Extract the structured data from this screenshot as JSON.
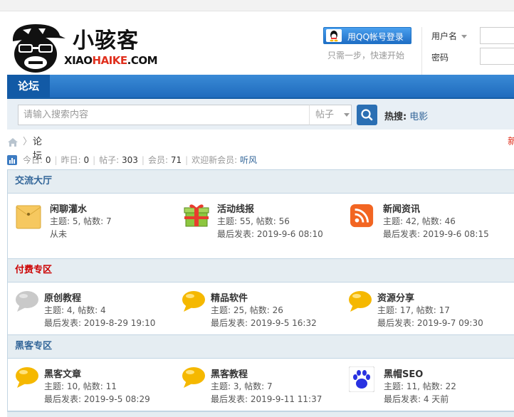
{
  "header": {
    "logo_text": "小骇客",
    "logo_domain_prefix": "XIAO",
    "logo_domain_highlight": "HAIKE",
    "logo_domain_suffix": ".COM",
    "qq_login_label": "用QQ帐号登录",
    "qq_tip": "只需一步，快速开始",
    "username_label": "用户名",
    "password_label": "密码"
  },
  "nav": {
    "active_tab": "论坛"
  },
  "search": {
    "placeholder": "请输入搜索内容",
    "scope": "帖子",
    "hot_label": "热搜:",
    "hot_links": [
      "电影"
    ]
  },
  "breadcrumb": {
    "current": "论坛",
    "right_cut": "新"
  },
  "stats": {
    "today_label": "今日:",
    "today": "0",
    "yesterday_label": "昨日:",
    "yesterday": "0",
    "posts_label": "帖子:",
    "posts": "303",
    "members_label": "会员:",
    "members": "71",
    "welcome_label": "欢迎新会员:",
    "new_member": "听风"
  },
  "sections": [
    {
      "title": "交流大厅",
      "forums": [
        {
          "name": "闲聊灌水",
          "line1": "主题: 5, 帖数: 7",
          "line2": "从未",
          "icon": "folder-icon"
        },
        {
          "name": "活动线报",
          "line1": "主题: 55, 帖数: 56",
          "line2": "最后发表: 2019-9-6 08:10",
          "icon": "gift-icon"
        },
        {
          "name": "新闻资讯",
          "line1": "主题: 42, 帖数: 46",
          "line2": "最后发表: 2019-9-6 08:15",
          "icon": "rss-icon"
        }
      ]
    },
    {
      "title": "付费专区",
      "forums": [
        {
          "name": "原创教程",
          "line1": "主题: 4, 帖数: 4",
          "line2": "最后发表: 2019-8-29 19:10",
          "icon": "gray-bubble-icon"
        },
        {
          "name": "精品软件",
          "line1": "主题: 25, 帖数: 26",
          "line2": "最后发表: 2019-9-5 16:32",
          "icon": "yellow-bubble-icon"
        },
        {
          "name": "资源分享",
          "line1": "主题: 17, 帖数: 17",
          "line2": "最后发表: 2019-9-7 09:30",
          "icon": "yellow-bubble-icon"
        }
      ]
    },
    {
      "title": "黑客专区",
      "forums": [
        {
          "name": "黑客文章",
          "line1": "主题: 10, 帖数: 11",
          "line2": "最后发表: 2019-9-5 08:29",
          "icon": "yellow-bubble-icon"
        },
        {
          "name": "黑客教程",
          "line1": "主题: 3, 帖数: 7",
          "line2": "最后发表: 2019-9-11 11:37",
          "icon": "yellow-bubble-icon"
        },
        {
          "name": "黑帽SEO",
          "line1": "主题: 11, 帖数: 22",
          "line2": "最后发表: 4 天前",
          "icon": "paw-icon"
        }
      ]
    }
  ],
  "colors": {
    "nav_blue": "#1f6bbd",
    "section_header_bg": "#e5edf2",
    "link_blue": "#336699",
    "paid_red": "#cc0000"
  }
}
